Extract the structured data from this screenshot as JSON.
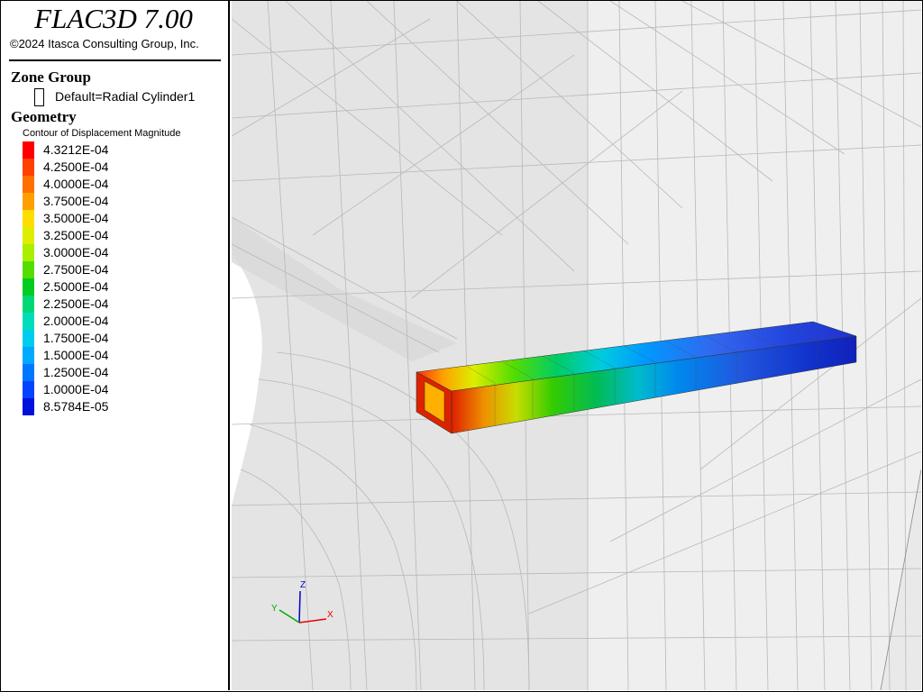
{
  "app": {
    "title": "FLAC3D 7.00",
    "copyright": "©2024 Itasca Consulting Group, Inc."
  },
  "legend": {
    "zone_group": {
      "heading": "Zone Group",
      "entry": "Default=Radial Cylinder1"
    },
    "geometry": {
      "heading": "Geometry",
      "contour_title": "Contour of Displacement Magnitude",
      "levels": [
        {
          "label": "4.3212E-04",
          "color": "#ff0000"
        },
        {
          "label": "4.2500E-04",
          "color": "#ff4000"
        },
        {
          "label": "4.0000E-04",
          "color": "#ff7000"
        },
        {
          "label": "3.7500E-04",
          "color": "#ffa000"
        },
        {
          "label": "3.5000E-04",
          "color": "#ffdd00"
        },
        {
          "label": "3.2500E-04",
          "color": "#ddee00"
        },
        {
          "label": "3.0000E-04",
          "color": "#aaee00"
        },
        {
          "label": "2.7500E-04",
          "color": "#55dd00"
        },
        {
          "label": "2.5000E-04",
          "color": "#00cc22"
        },
        {
          "label": "2.2500E-04",
          "color": "#00d877"
        },
        {
          "label": "2.0000E-04",
          "color": "#00ddbb"
        },
        {
          "label": "1.7500E-04",
          "color": "#00ccee"
        },
        {
          "label": "1.5000E-04",
          "color": "#00aaff"
        },
        {
          "label": "1.2500E-04",
          "color": "#0077ff"
        },
        {
          "label": "1.0000E-04",
          "color": "#0044ff"
        },
        {
          "label": "8.5784E-05",
          "color": "#0011dd"
        }
      ]
    }
  },
  "axes": {
    "x": "X",
    "y": "Y",
    "z": "Z"
  }
}
